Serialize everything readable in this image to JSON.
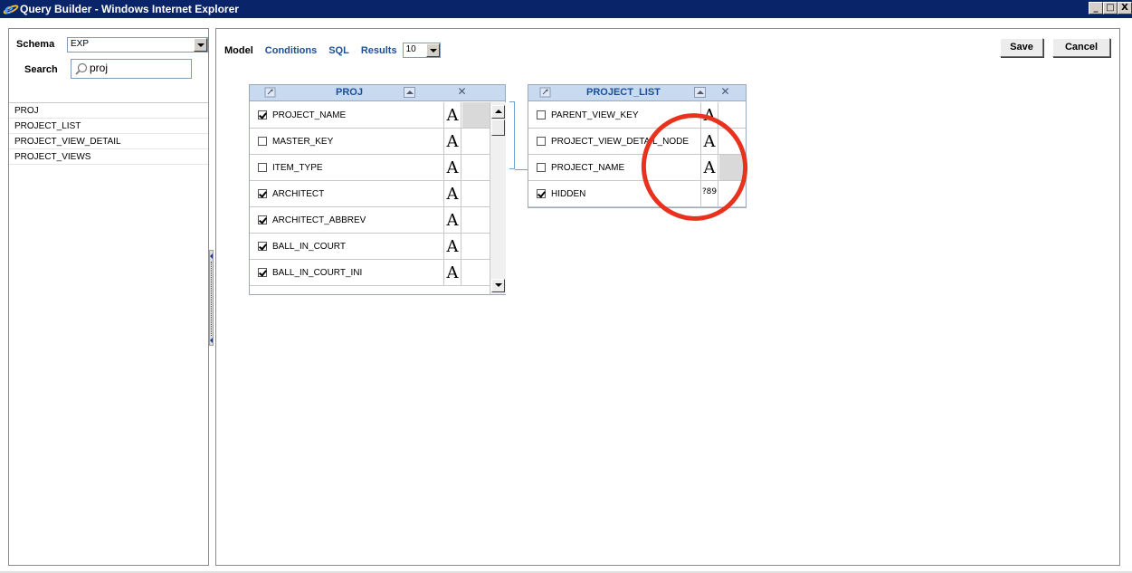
{
  "window": {
    "title": "Query Builder - Windows Internet Explorer",
    "controls": {
      "minimize": "_",
      "maximize": "□",
      "close": "X"
    }
  },
  "left": {
    "schema_label": "Schema",
    "schema_value": "EXP",
    "search_label": "Search",
    "search_value": "proj",
    "tables": [
      "PROJ",
      "PROJECT_LIST",
      "PROJECT_VIEW_DETAIL",
      "PROJECT_VIEWS"
    ]
  },
  "toolbar": {
    "tabs": [
      "Model",
      "Conditions",
      "SQL",
      "Results"
    ],
    "results_count": "10",
    "save": "Save",
    "cancel": "Cancel"
  },
  "proj_table": {
    "name": "PROJ",
    "columns": [
      {
        "name": "PROJECT_NAME",
        "checked": true,
        "type": "A"
      },
      {
        "name": "MASTER_KEY",
        "checked": false,
        "type": "A"
      },
      {
        "name": "ITEM_TYPE",
        "checked": false,
        "type": "A"
      },
      {
        "name": "ARCHITECT",
        "checked": true,
        "type": "A"
      },
      {
        "name": "ARCHITECT_ABBREV",
        "checked": true,
        "type": "A"
      },
      {
        "name": "BALL_IN_COURT",
        "checked": true,
        "type": "A"
      },
      {
        "name": "BALL_IN_COURT_INI",
        "checked": true,
        "type": "A"
      }
    ]
  },
  "project_list_table": {
    "name": "PROJECT_LIST",
    "columns": [
      {
        "name": "PARENT_VIEW_KEY",
        "checked": false,
        "type": "A"
      },
      {
        "name": "PROJECT_VIEW_DETAIL_NODE",
        "checked": false,
        "type": "A"
      },
      {
        "name": "PROJECT_NAME",
        "checked": false,
        "type": "A"
      },
      {
        "name": "HIDDEN",
        "checked": true,
        "type": "?89"
      }
    ]
  },
  "colors": {
    "titlebar": "#0a246a",
    "link_blue": "#1b4f97",
    "table_header": "#c7daf0",
    "highlight": "#e8321e"
  }
}
